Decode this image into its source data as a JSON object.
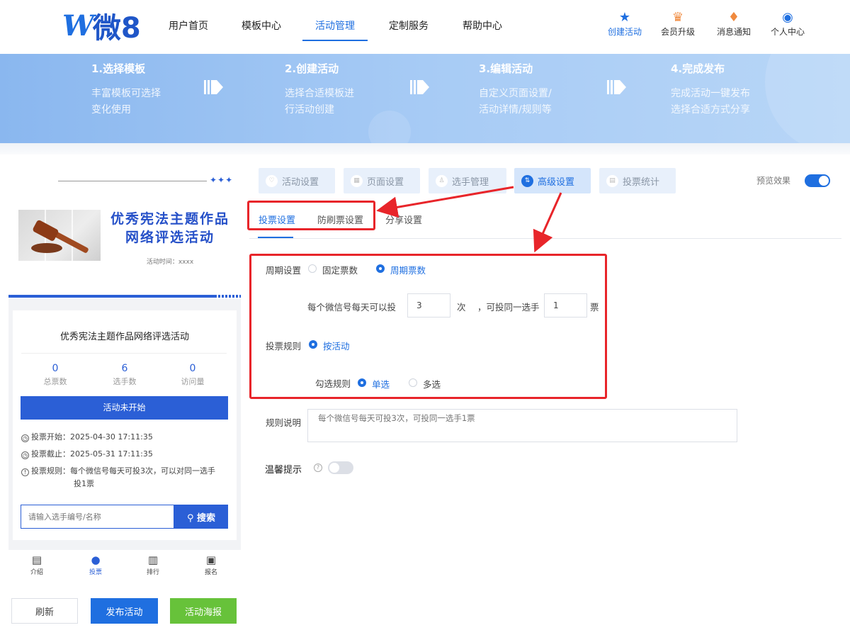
{
  "header": {
    "logo_mark": "W",
    "logo_text": "微8",
    "nav": [
      "用户首页",
      "模板中心",
      "活动管理",
      "定制服务",
      "帮助中心"
    ],
    "active_nav": "活动管理",
    "tools": [
      {
        "label": "创建活动",
        "icon": "star-icon"
      },
      {
        "label": "会员升级",
        "icon": "crown-icon"
      },
      {
        "label": "消息通知",
        "icon": "bell-icon"
      },
      {
        "label": "个人中心",
        "icon": "user-icon"
      }
    ]
  },
  "banner": {
    "steps": [
      {
        "title": "1.选择模板",
        "desc1": "丰富模板可选择",
        "desc2": "变化使用"
      },
      {
        "title": "2.创建活动",
        "desc1": "选择合适模板进",
        "desc2": "行活动创建"
      },
      {
        "title": "3.编辑活动",
        "desc1": "自定义页面设置/",
        "desc2": "活动详情/规则等"
      },
      {
        "title": "4.完成发布",
        "desc1": "完成活动一键发布",
        "desc2": "选择合适方式分享"
      }
    ]
  },
  "preview": {
    "cover_title_line1": "优秀宪法主题作品",
    "cover_title_line2": "网络评选活动",
    "cover_time": "活动时间：xxxx",
    "cover_dots": "✦✦✦",
    "card_title": "优秀宪法主题作品网络评选活动",
    "stats": [
      {
        "value": "0",
        "label": "总票数"
      },
      {
        "value": "6",
        "label": "选手数"
      },
      {
        "value": "0",
        "label": "访问量"
      }
    ],
    "status_button": "活动未开始",
    "vote_start": "投票开始：2025-04-30 17:11:35",
    "vote_end": "投票截止：2025-05-31 17:11:35",
    "vote_rule_line1": "投票规则：每个微信号每天可投3次，可以对同一选手",
    "vote_rule_line2": "投1票",
    "search_placeholder": "请输入选手编号/名称",
    "search_button": "搜索",
    "bottom_nav": [
      {
        "label": "介绍",
        "icon": "intro-icon"
      },
      {
        "label": "投票",
        "icon": "vote-icon"
      },
      {
        "label": "排行",
        "icon": "rank-icon"
      },
      {
        "label": "报名",
        "icon": "signup-icon"
      }
    ],
    "active_bottom_nav": "投票"
  },
  "actions": {
    "refresh": "刷新",
    "publish": "发布活动",
    "poster": "活动海报"
  },
  "colors": {
    "primary": "#1f6fe0",
    "preview_blue": "#2b5fd6",
    "highlight_red": "#e8252a",
    "poster_green": "#67c23a"
  },
  "settings": {
    "main_tabs": [
      {
        "label": "活动设置",
        "icon": "heart-icon"
      },
      {
        "label": "页面设置",
        "icon": "page-icon"
      },
      {
        "label": "选手管理",
        "icon": "person-icon"
      },
      {
        "label": "高级设置",
        "icon": "sliders-icon"
      },
      {
        "label": "投票统计",
        "icon": "chart-icon"
      }
    ],
    "active_main_tab": "高级设置",
    "preview_label": "预览效果",
    "preview_on": true,
    "sub_tabs": [
      "投票设置",
      "防刷票设置",
      "分享设置"
    ],
    "active_sub_tab": "投票设置",
    "cycle_label": "周期设置",
    "cycle_options": [
      "固定票数",
      "周期票数"
    ],
    "cycle_selected": "周期票数",
    "per_day_prefix": "每个微信号每天可以投",
    "per_day_value": "3",
    "times_unit": "次",
    "same_player_text": "，可投同一选手",
    "same_player_value": "1",
    "votes_unit": "票",
    "vote_rule_label": "投票规则",
    "vote_rule_option": "按活动",
    "check_rule_label": "勾选规则",
    "check_options": [
      "单选",
      "多选"
    ],
    "check_selected": "单选",
    "rules_desc_label": "规则说明",
    "rules_desc_placeholder": "每个微信号每天可投3次，可投同一选手1票",
    "tips_label": "温馨提示",
    "tips_on": false
  }
}
